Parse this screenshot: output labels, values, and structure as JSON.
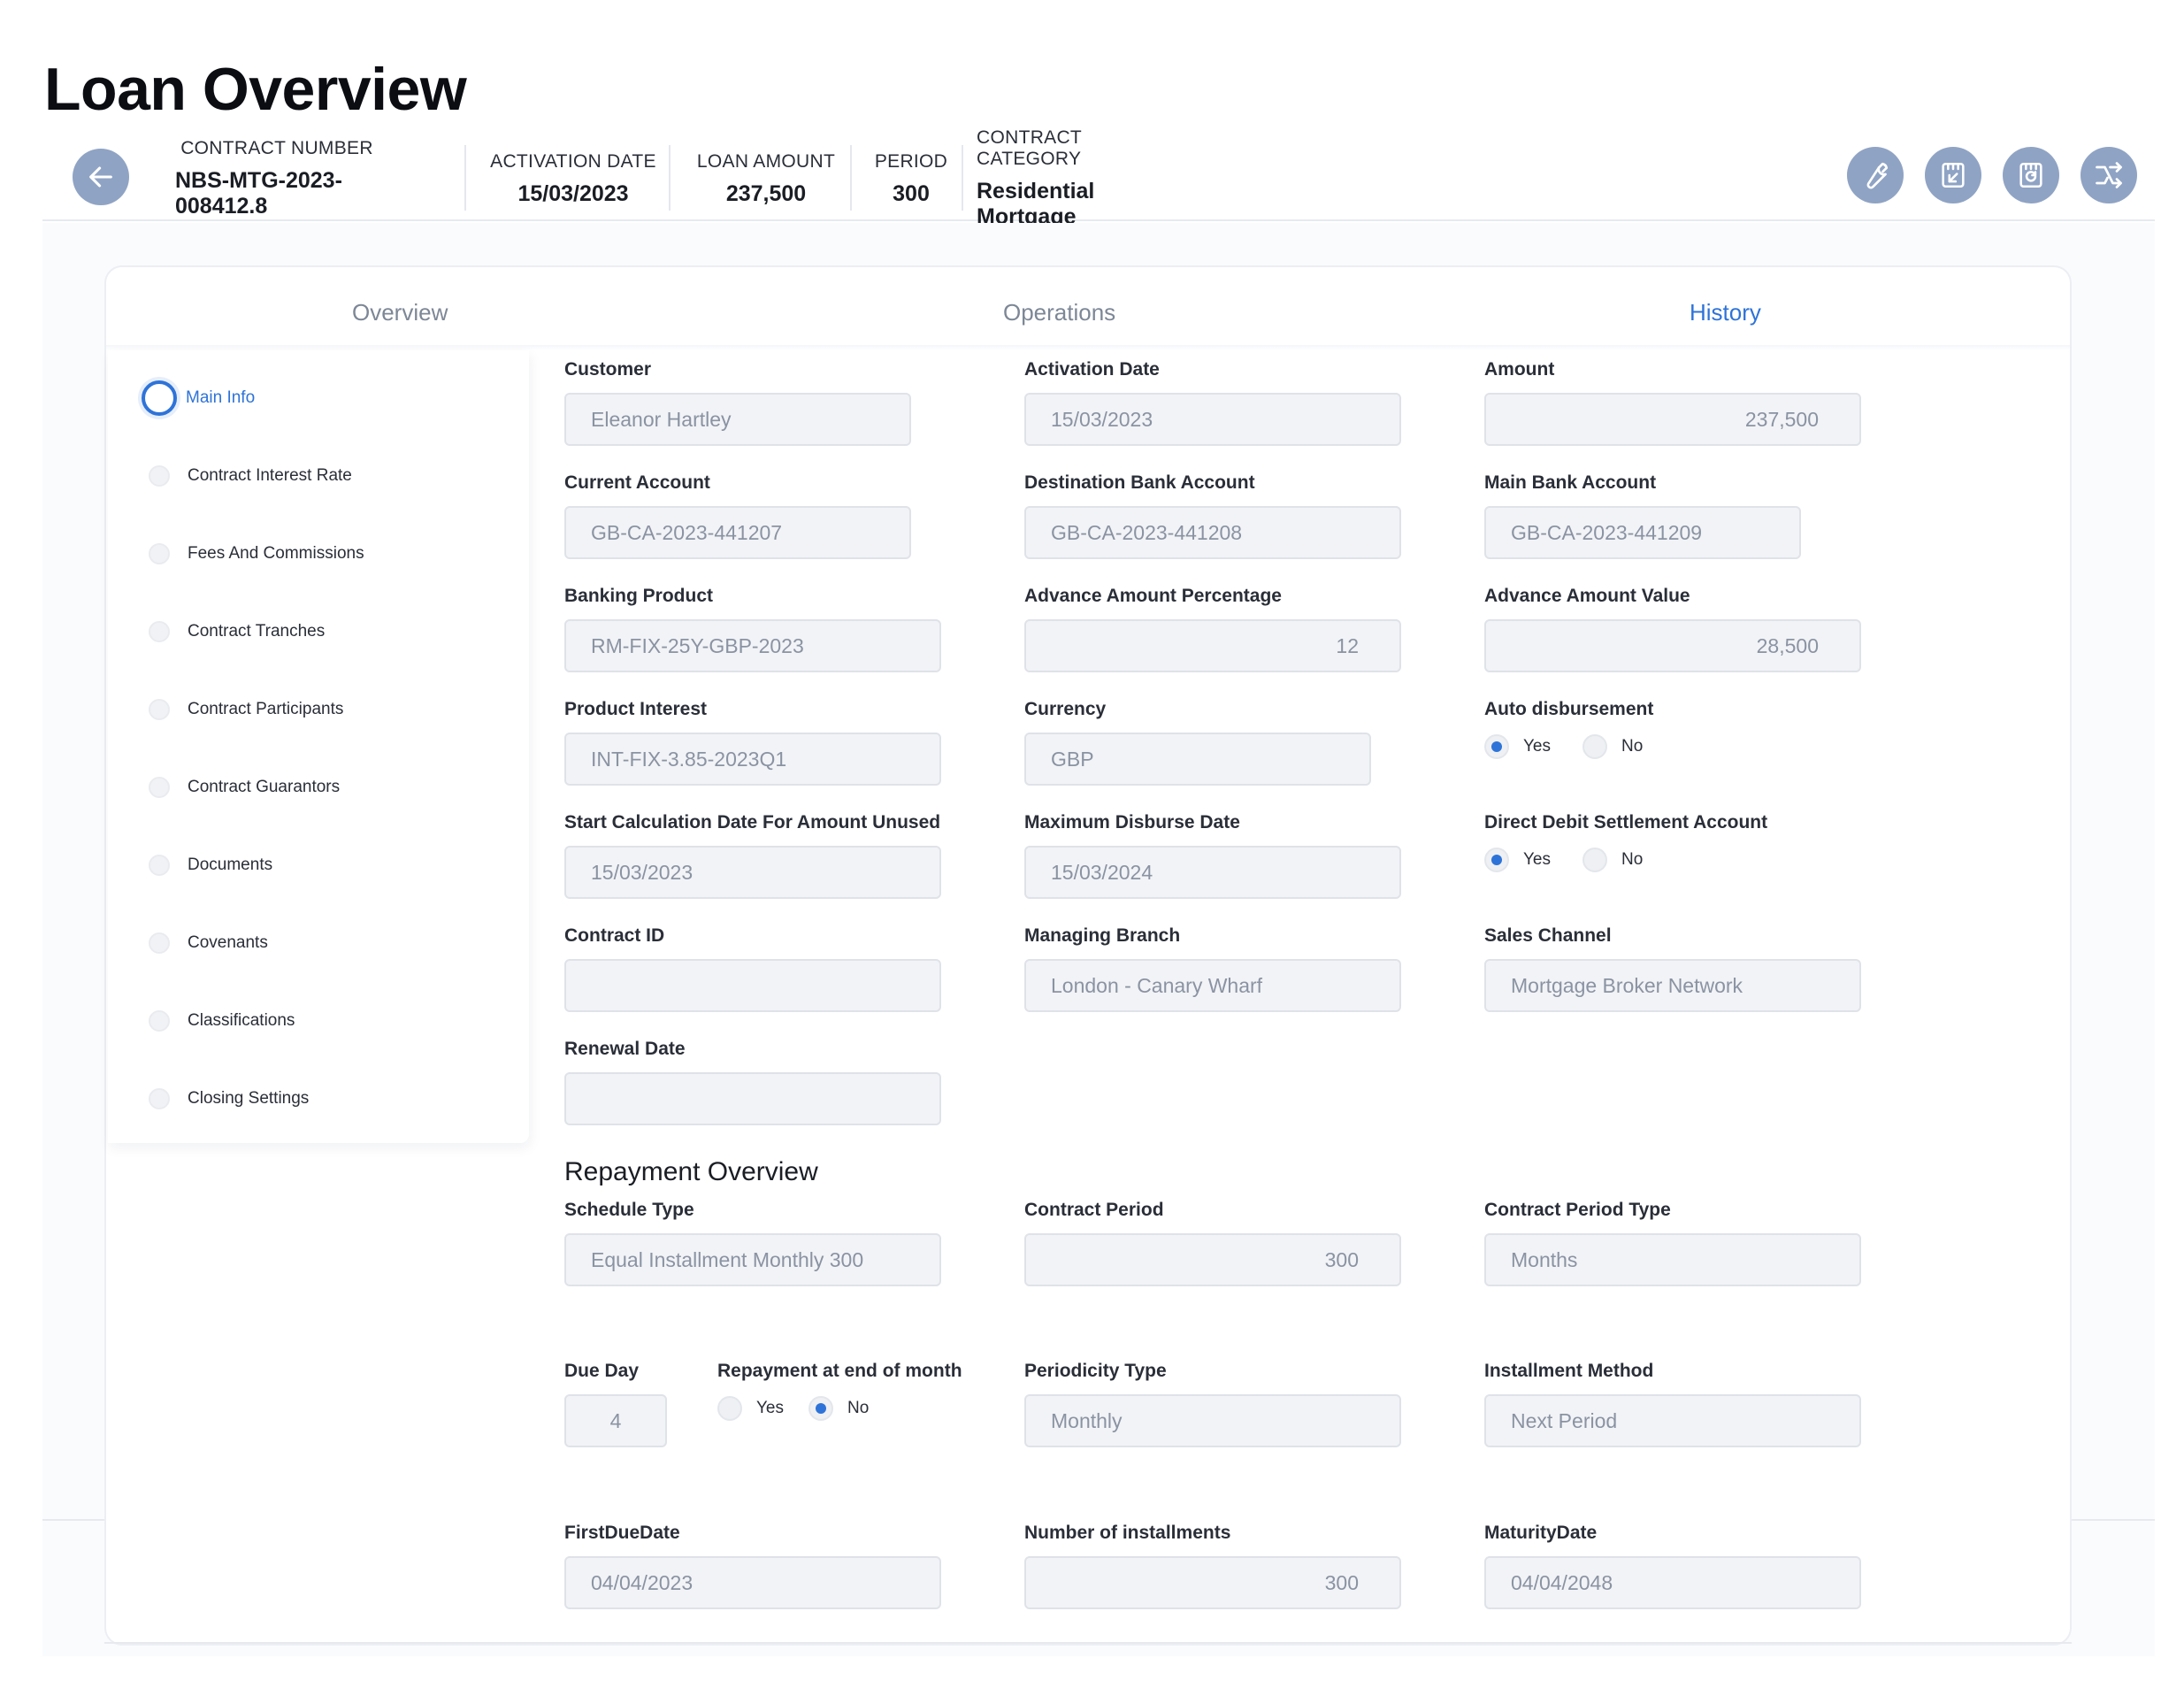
{
  "page": {
    "title": "Loan Overview"
  },
  "header": {
    "contract_number_label": "CONTRACT NUMBER",
    "contract_number": "NBS-MTG-2023-008412.8",
    "activation_date_label": "ACTIVATION DATE",
    "activation_date": "15/03/2023",
    "loan_amount_label": "LOAN AMOUNT",
    "loan_amount": "237,500",
    "period_label": "PERIOD",
    "period": "300",
    "contract_category_label": "CONTRACT CATEGORY",
    "contract_category": "Residential Mortgage",
    "icons": [
      "arrow-left-icon",
      "wrench-icon",
      "document-import-icon",
      "document-refresh-icon",
      "split-arrow-icon"
    ]
  },
  "tabs": [
    "Overview",
    "Operations",
    "History"
  ],
  "active_tab": "History",
  "sidebar": {
    "items": [
      "Main Info",
      "Contract Interest Rate",
      "Fees And Commissions",
      "Contract Tranches",
      "Contract Participants",
      "Contract Guarantors",
      "Documents",
      "Covenants",
      "Classifications",
      "Closing Settings"
    ],
    "active": "Main Info"
  },
  "main_info": {
    "customer": {
      "label": "Customer",
      "value": "Eleanor Hartley"
    },
    "activation_date": {
      "label": "Activation Date",
      "value": "15/03/2023"
    },
    "amount": {
      "label": "Amount",
      "value": "237,500"
    },
    "current_account": {
      "label": "Current Account",
      "value": "GB-CA-2023-441207"
    },
    "destination_bank_account": {
      "label": "Destination Bank Account",
      "value": "GB-CA-2023-441208"
    },
    "main_bank_account": {
      "label": "Main Bank Account",
      "value": "GB-CA-2023-441209"
    },
    "banking_product": {
      "label": "Banking Product",
      "value": "RM-FIX-25Y-GBP-2023"
    },
    "advance_amount_percentage": {
      "label": "Advance Amount Percentage",
      "value": "12"
    },
    "advance_amount_value": {
      "label": "Advance Amount Value",
      "value": "28,500"
    },
    "product_interest": {
      "label": "Product Interest",
      "value": "INT-FIX-3.85-2023Q1"
    },
    "currency": {
      "label": "Currency",
      "value": "GBP"
    },
    "auto_disbursement": {
      "label": "Auto disbursement",
      "yes": "Yes",
      "no": "No",
      "selected": "Yes"
    },
    "start_calc_date": {
      "label": "Start Calculation Date For Amount Unused",
      "value": "15/03/2023"
    },
    "max_disburse_date": {
      "label": "Maximum Disburse Date",
      "value": "15/03/2024"
    },
    "direct_debit": {
      "label": "Direct Debit Settlement Account",
      "yes": "Yes",
      "no": "No",
      "selected": "Yes"
    },
    "contract_id": {
      "label": "Contract ID",
      "value": ""
    },
    "managing_branch": {
      "label": "Managing Branch",
      "value": "London - Canary Wharf"
    },
    "sales_channel": {
      "label": "Sales Channel",
      "value": "Mortgage Broker Network"
    },
    "renewal_date": {
      "label": "Renewal Date",
      "value": ""
    }
  },
  "repayment": {
    "title": "Repayment Overview",
    "schedule_type": {
      "label": "Schedule Type",
      "value": "Equal Installment Monthly 300"
    },
    "contract_period": {
      "label": "Contract Period",
      "value": "300"
    },
    "contract_period_type": {
      "label": "Contract Period Type",
      "value": "Months"
    },
    "due_day": {
      "label": "Due Day",
      "value": "4"
    },
    "repayment_end_of_month": {
      "label": "Repayment at end of month",
      "yes": "Yes",
      "no": "No",
      "selected": "No"
    },
    "periodicity_type": {
      "label": "Periodicity Type",
      "value": "Monthly"
    },
    "installment_method": {
      "label": "Installment Method",
      "value": "Next Period"
    },
    "first_due_date": {
      "label": "FirstDueDate",
      "value": "04/04/2023"
    },
    "number_of_installments": {
      "label": "Number of installments",
      "value": "300"
    },
    "maturity_date": {
      "label": "MaturityDate",
      "value": "04/04/2048"
    }
  },
  "colors": {
    "accent": "#2e73d8",
    "icon_button": "#8fa3c4",
    "input_bg": "#f2f3f6",
    "input_border": "#dfe2e8"
  }
}
